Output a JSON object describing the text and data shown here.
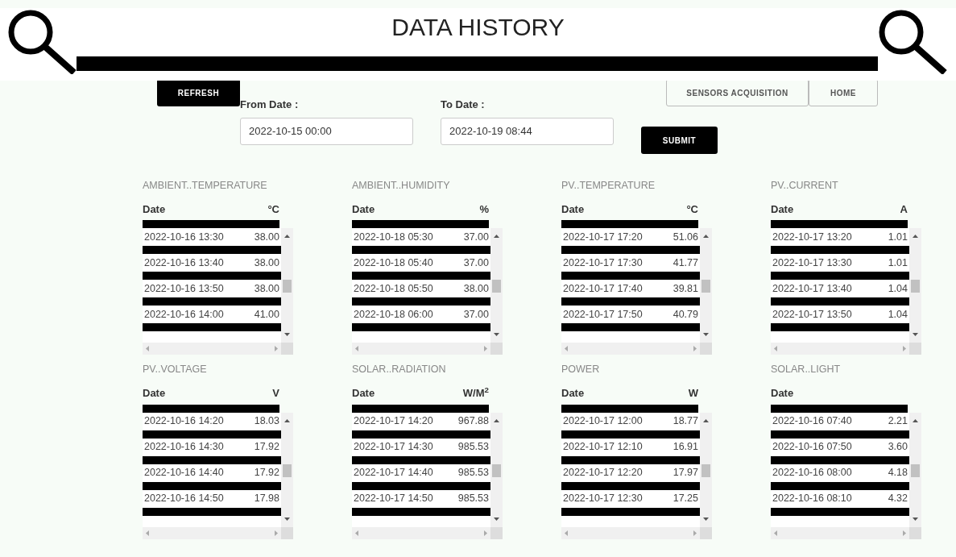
{
  "header": {
    "title": "DATA HISTORY"
  },
  "buttons": {
    "refresh": "REFRESH",
    "sensors": "SENSORS ACQUISITION",
    "home": "HOME",
    "submit": "SUBMIT"
  },
  "filters": [
    {
      "label": "From Date :",
      "value": "2022-10-15 00:00"
    },
    {
      "label": "To Date :",
      "value": "2022-10-19 08:44"
    }
  ],
  "panels": [
    {
      "title": "AMBIENT..TEMPERATURE",
      "date_heading": "Date",
      "unit": "°C",
      "rows": [
        {
          "date": "2022-10-16 13:30",
          "value": "38.00"
        },
        {
          "date": "2022-10-16 13:40",
          "value": "38.00"
        },
        {
          "date": "2022-10-16 13:50",
          "value": "38.00"
        },
        {
          "date": "2022-10-16 14:00",
          "value": "41.00"
        }
      ]
    },
    {
      "title": "AMBIENT..HUMIDITY",
      "date_heading": "Date",
      "unit": "%",
      "rows": [
        {
          "date": "2022-10-18 05:30",
          "value": "37.00"
        },
        {
          "date": "2022-10-18 05:40",
          "value": "37.00"
        },
        {
          "date": "2022-10-18 05:50",
          "value": "38.00"
        },
        {
          "date": "2022-10-18 06:00",
          "value": "37.00"
        }
      ]
    },
    {
      "title": "PV..TEMPERATURE",
      "date_heading": "Date",
      "unit": "°C",
      "rows": [
        {
          "date": "2022-10-17 17:20",
          "value": "51.06"
        },
        {
          "date": "2022-10-17 17:30",
          "value": "41.77"
        },
        {
          "date": "2022-10-17 17:40",
          "value": "39.81"
        },
        {
          "date": "2022-10-17 17:50",
          "value": "40.79"
        }
      ]
    },
    {
      "title": "PV..CURRENT",
      "date_heading": "Date",
      "unit": "A",
      "rows": [
        {
          "date": "2022-10-17 13:20",
          "value": "1.01"
        },
        {
          "date": "2022-10-17 13:30",
          "value": "1.01"
        },
        {
          "date": "2022-10-17 13:40",
          "value": "1.04"
        },
        {
          "date": "2022-10-17 13:50",
          "value": "1.04"
        }
      ]
    },
    {
      "title": "PV..VOLTAGE",
      "date_heading": "Date",
      "unit": "V",
      "rows": [
        {
          "date": "2022-10-16 14:20",
          "value": "18.03"
        },
        {
          "date": "2022-10-16 14:30",
          "value": "17.92"
        },
        {
          "date": "2022-10-16 14:40",
          "value": "17.92"
        },
        {
          "date": "2022-10-16 14:50",
          "value": "17.98"
        }
      ]
    },
    {
      "title": "SOLAR..RADIATION",
      "date_heading": "Date",
      "unit": "W/M$^{2}$",
      "rows": [
        {
          "date": "2022-10-17 14:20",
          "value": "967.88"
        },
        {
          "date": "2022-10-17 14:30",
          "value": "985.53"
        },
        {
          "date": "2022-10-17 14:40",
          "value": "985.53"
        },
        {
          "date": "2022-10-17 14:50",
          "value": "985.53"
        }
      ]
    },
    {
      "title": "POWER",
      "date_heading": "Date",
      "unit": "W",
      "rows": [
        {
          "date": "2022-10-17 12:00",
          "value": "18.77"
        },
        {
          "date": "2022-10-17 12:10",
          "value": "16.91"
        },
        {
          "date": "2022-10-17 12:20",
          "value": "17.97"
        },
        {
          "date": "2022-10-17 12:30",
          "value": "17.25"
        }
      ]
    },
    {
      "title": "SOLAR..LIGHT",
      "date_heading": "Date",
      "rows": [
        {
          "date": "2022-10-16 07:40",
          "value": "2.21"
        },
        {
          "date": "2022-10-16 07:50",
          "value": "3.60"
        },
        {
          "date": "2022-10-16 08:00",
          "value": "4.18"
        },
        {
          "date": "2022-10-16 08:10",
          "value": "4.32"
        }
      ]
    }
  ]
}
